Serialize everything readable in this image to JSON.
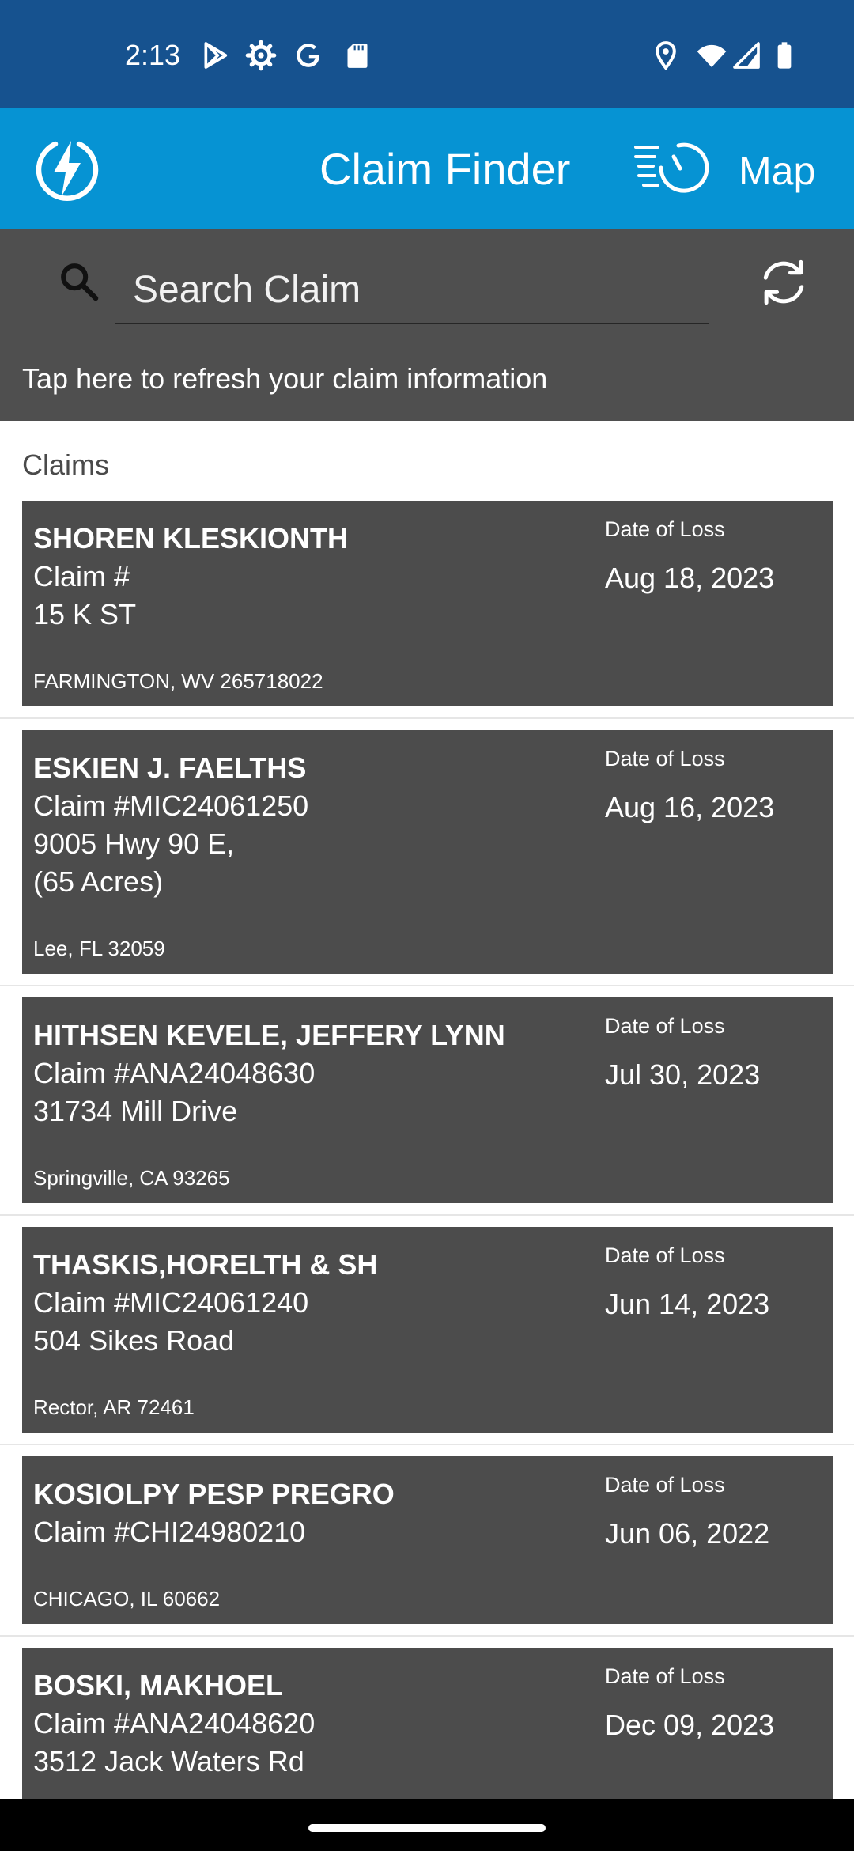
{
  "status_bar": {
    "time": "2:13"
  },
  "app_bar": {
    "title": "Claim Finder",
    "map_label": "Map"
  },
  "search": {
    "placeholder": "Search Claim",
    "refresh_hint": "Tap here to refresh your claim information"
  },
  "claims": {
    "header": "Claims",
    "date_label": "Date of Loss",
    "items": [
      {
        "name": "SHOREN KLESKIONTH",
        "claim": "Claim #",
        "address": [
          "15 K ST"
        ],
        "city": "FARMINGTON, WV 265718022",
        "date": "Aug 18, 2023"
      },
      {
        "name": "ESKIEN J. FAELTHS",
        "claim": "Claim #MIC24061250",
        "address": [
          "9005 Hwy 90 E,",
          "(65 Acres)"
        ],
        "city": "Lee, FL 32059",
        "date": "Aug 16, 2023"
      },
      {
        "name": "HITHSEN KEVELE, JEFFERY LYNN",
        "claim": "Claim #ANA24048630",
        "address": [
          "31734 Mill Drive"
        ],
        "city": "Springville, CA 93265",
        "date": "Jul 30, 2023"
      },
      {
        "name": "THASKIS,HORELTH & SH",
        "claim": "Claim #MIC24061240",
        "address": [
          "504 Sikes Road"
        ],
        "city": "Rector, AR 72461",
        "date": "Jun 14, 2023"
      },
      {
        "name": "KOSIOLPY PESP PREGRO",
        "claim": "Claim #CHI24980210",
        "address": [],
        "city": "CHICAGO, IL 60662",
        "date": "Jun 06, 2022"
      },
      {
        "name": "BOSKI, MAKHOEL",
        "claim": "Claim #ANA24048620",
        "address": [
          "3512 Jack Waters Rd"
        ],
        "city": "",
        "date": "Dec 09, 2023"
      }
    ]
  },
  "icons": {
    "play_store": "play-store-icon",
    "settings": "gear-icon",
    "google": "google-icon",
    "sd_card": "sd-card-icon",
    "location": "location-icon",
    "wifi": "wifi-icon",
    "signal": "signal-icon",
    "battery": "battery-icon",
    "app_logo": "lightning-bolt-icon",
    "map": "map-timer-icon",
    "search": "search-icon",
    "refresh": "refresh-icon"
  },
  "colors": {
    "status_bar": "#16528f",
    "app_bar": "#0693d3",
    "search_panel": "#4f4f4f",
    "card": "#4c4c4c"
  }
}
